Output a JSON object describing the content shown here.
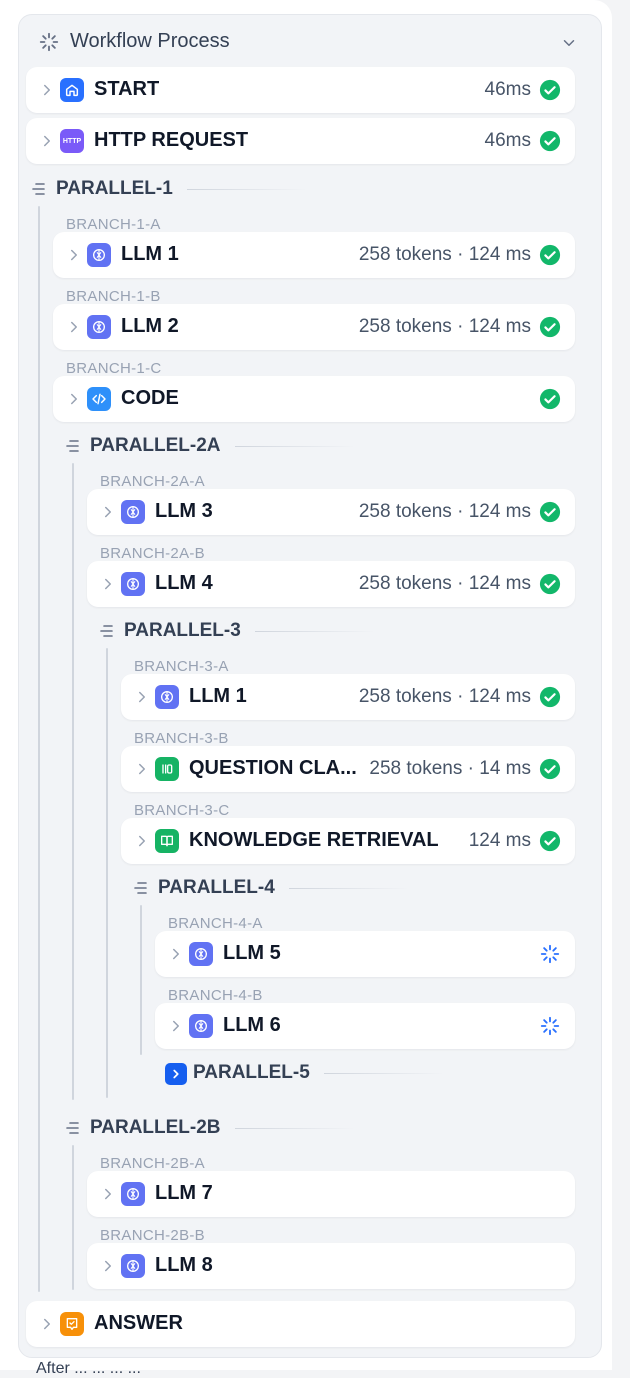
{
  "header": {
    "title": "Workflow Process"
  },
  "nodes": {
    "start": {
      "title": "START",
      "meta": "46ms"
    },
    "http": {
      "title": "HTTP REQUEST",
      "meta": "46ms",
      "badge": "HTTP"
    },
    "llm1": {
      "title": "LLM 1",
      "meta": "258 tokens · 124 ms"
    },
    "llm2": {
      "title": "LLM 2",
      "meta": "258 tokens · 124 ms"
    },
    "code": {
      "title": "CODE",
      "meta": ""
    },
    "llm3": {
      "title": "LLM 3",
      "meta": "258 tokens · 124 ms"
    },
    "llm4": {
      "title": "LLM 4",
      "meta": "258 tokens · 124 ms"
    },
    "llm1b": {
      "title": "LLM 1",
      "meta": "258 tokens · 124 ms"
    },
    "qc": {
      "title": "QUESTION CLA...",
      "meta": "258 tokens · 14 ms"
    },
    "kr": {
      "title": "KNOWLEDGE RETRIEVAL",
      "meta": "124 ms"
    },
    "llm5": {
      "title": "LLM 5",
      "meta": ""
    },
    "llm6": {
      "title": "LLM 6",
      "meta": ""
    },
    "llm7": {
      "title": "LLM 7",
      "meta": ""
    },
    "llm8": {
      "title": "LLM 8",
      "meta": ""
    },
    "answer": {
      "title": "ANSWER",
      "meta": ""
    }
  },
  "parallels": {
    "p1": "PARALLEL-1",
    "p2a": "PARALLEL-2A",
    "p3": "PARALLEL-3",
    "p4": "PARALLEL-4",
    "p5": "PARALLEL-5",
    "p2b": "PARALLEL-2B"
  },
  "branches": {
    "b1a": "BRANCH-1-A",
    "b1b": "BRANCH-1-B",
    "b1c": "BRANCH-1-C",
    "b2aa": "BRANCH-2A-A",
    "b2ab": "BRANCH-2A-B",
    "b3a": "BRANCH-3-A",
    "b3b": "BRANCH-3-B",
    "b3c": "BRANCH-3-C",
    "b4a": "BRANCH-4-A",
    "b4b": "BRANCH-4-B",
    "b2ba": "BRANCH-2B-A",
    "b2bb": "BRANCH-2B-B"
  },
  "footer": {
    "partial_text": "After ... ... ... ..."
  },
  "icons": {
    "start": "home-icon",
    "http": "http-icon",
    "llm": "llm-icon",
    "code": "code-icon",
    "question_classifier": "question-classifier-icon",
    "knowledge_retrieval": "knowledge-retrieval-icon",
    "answer": "answer-icon",
    "success": "check-circle-icon",
    "running": "spinner-icon"
  },
  "colors": {
    "success": "#12b76a",
    "running": "#2970ff",
    "start": "#2970ff",
    "http": "#7a5af8",
    "llm": "#6172f3",
    "code": "#2e90fa",
    "question_classifier": "#16b364",
    "knowledge_retrieval": "#16b364",
    "answer": "#f79009",
    "expand": "#155eef"
  }
}
